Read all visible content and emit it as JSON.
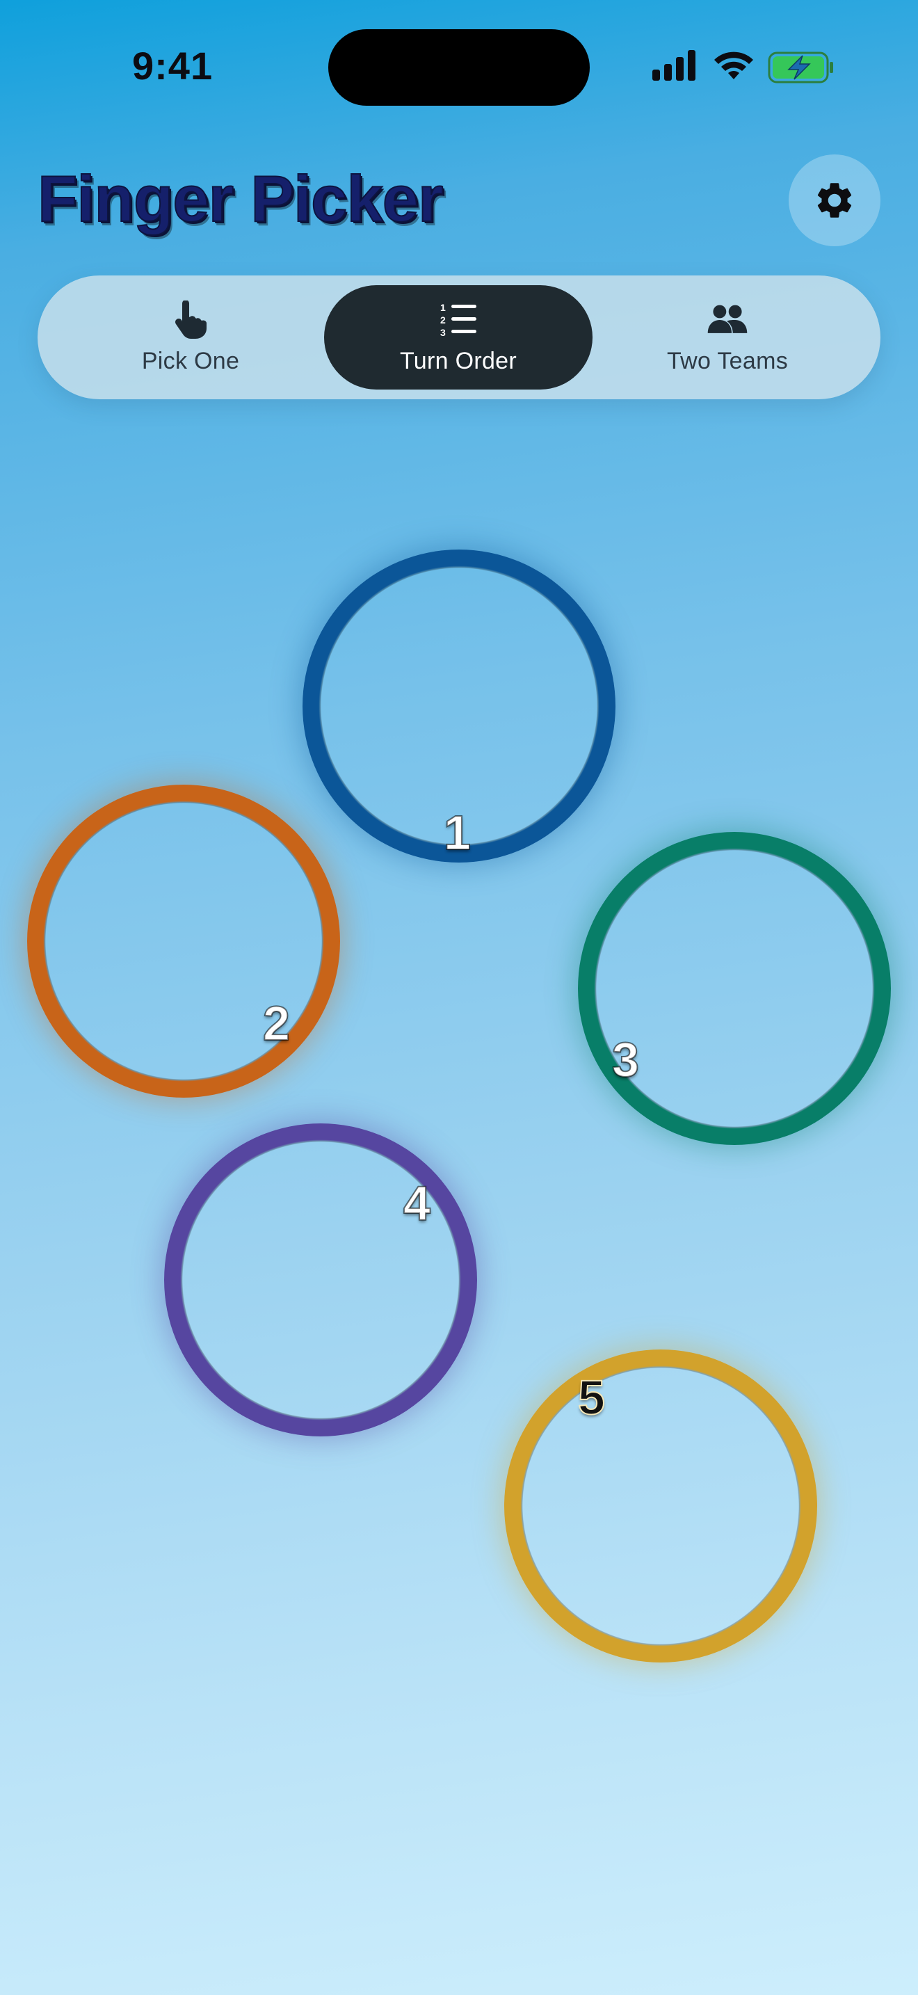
{
  "status_bar": {
    "time": "9:41",
    "icons": [
      "cellular-signal-icon",
      "wifi-icon",
      "battery-charging-icon"
    ]
  },
  "header": {
    "title": "Finger Picker",
    "settings_icon": "gear-icon"
  },
  "modes": {
    "selected": "Turn Order",
    "tabs": [
      {
        "label": "Pick One",
        "icon": "pointing-hand-icon"
      },
      {
        "label": "Turn Order",
        "icon": "numbered-list-icon"
      },
      {
        "label": "Two Teams",
        "icon": "two-people-icon"
      }
    ]
  },
  "touches": [
    {
      "order": "1",
      "color": "#0b5698"
    },
    {
      "order": "2",
      "color": "#c86419"
    },
    {
      "order": "3",
      "color": "#087e68"
    },
    {
      "order": "4",
      "color": "#5646a0"
    },
    {
      "order": "5",
      "color": "#d2a22c"
    }
  ],
  "colors": {
    "title": "#15206b",
    "selected_tab": "#1f2a30",
    "battery_fill": "#35c759"
  }
}
